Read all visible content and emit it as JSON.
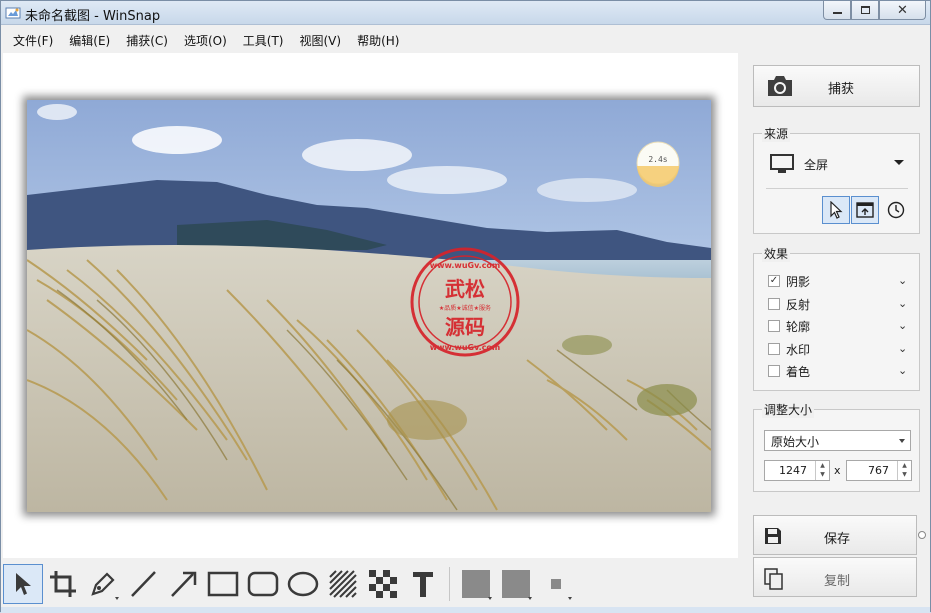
{
  "window": {
    "title": "未命名截图 - WinSnap",
    "app_icon": "winsnap-icon",
    "buttons": [
      "minimize-icon",
      "restore-icon",
      "close-icon"
    ]
  },
  "menu": {
    "items": [
      {
        "label": "文件(F)"
      },
      {
        "label": "编辑(E)"
      },
      {
        "label": "捕获(C)"
      },
      {
        "label": "选项(O)"
      },
      {
        "label": "工具(T)"
      },
      {
        "label": "视图(V)"
      },
      {
        "label": "帮助(H)"
      }
    ]
  },
  "image": {
    "description_icon": "landscape-photo",
    "badge_text": "2.4s",
    "watermark": {
      "top": "www.wuGv.com",
      "main_1": "武松",
      "main_2": "源码",
      "middle": "★品质★诚信★服务",
      "bottom": "www.wuGv.com"
    }
  },
  "side": {
    "capture_label": "捕获",
    "source": {
      "title": "来源",
      "selected": "全屏"
    },
    "effects": {
      "title": "效果",
      "items": [
        {
          "label": "阴影",
          "checked": true
        },
        {
          "label": "反射",
          "checked": false
        },
        {
          "label": "轮廓",
          "checked": false
        },
        {
          "label": "水印",
          "checked": false
        },
        {
          "label": "着色",
          "checked": false
        }
      ]
    },
    "resize": {
      "title": "调整大小",
      "mode": "原始大小",
      "width": "1247",
      "height": "767",
      "times": "x"
    },
    "save_label": "保存",
    "copy_label": "复制"
  },
  "tools": [
    "pointer-icon",
    "crop-icon",
    "pen-icon",
    "line-icon",
    "arrow-icon",
    "rectangle-icon",
    "rounded-rectangle-icon",
    "ellipse-icon",
    "hatch-icon",
    "pixelate-icon",
    "text-icon",
    "fill-color-icon",
    "line-color-icon",
    "line-width-icon"
  ],
  "colors": {
    "accent": "#5a8fcf",
    "tool_fill": "#8a8a8a"
  }
}
